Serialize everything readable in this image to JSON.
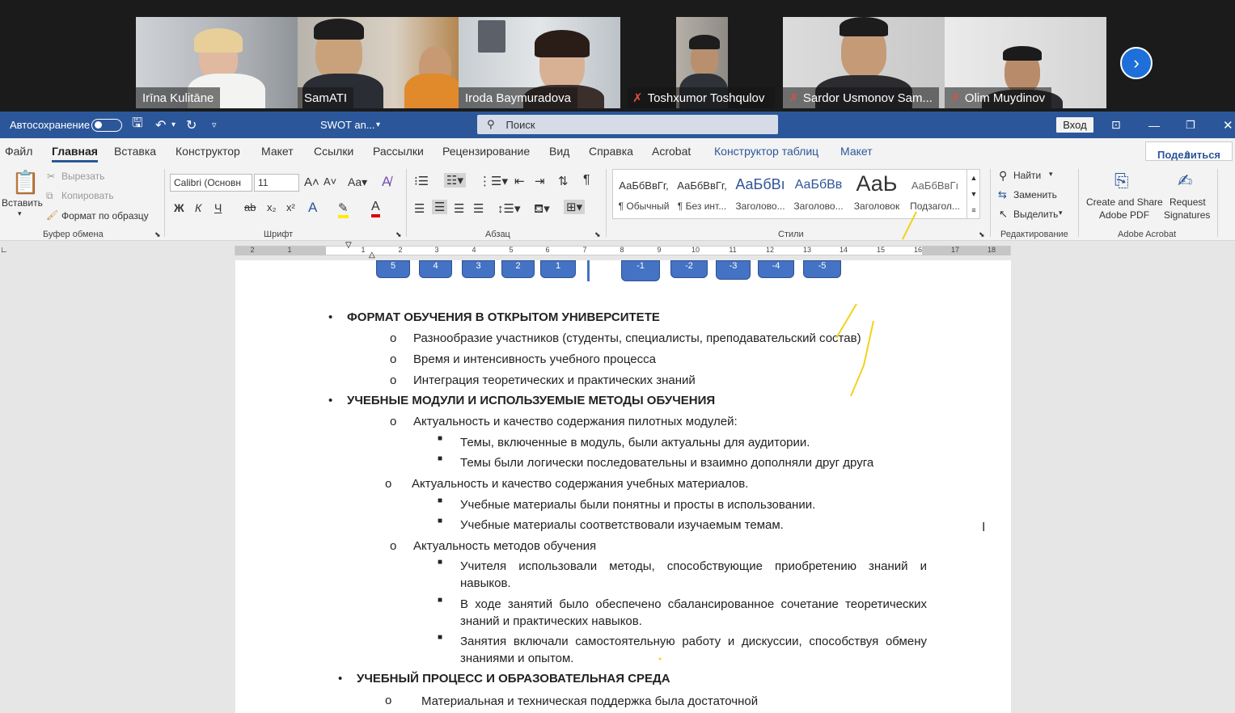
{
  "participants": [
    {
      "name": "Irīna Kulitāne",
      "muted": false
    },
    {
      "name": "SamATI",
      "muted": false
    },
    {
      "name": "Iroda Baymuradova",
      "muted": false
    },
    {
      "name": "Toshxumor Toshqulov",
      "muted": true
    },
    {
      "name": "Sardor Usmonov Sam...",
      "muted": true
    },
    {
      "name": "Olim Muydinov",
      "muted": true
    }
  ],
  "titlebar": {
    "autosave_label": "Автосохранение",
    "doc_title": "SWOT an...",
    "search_placeholder": "Поиск",
    "login": "Вход"
  },
  "menu": {
    "tabs": [
      "Файл",
      "Главная",
      "Вставка",
      "Конструктор",
      "Макет",
      "Ссылки",
      "Рассылки",
      "Рецензирование",
      "Вид",
      "Справка",
      "Acrobat",
      "Конструктор таблиц",
      "Макет"
    ],
    "share": "Поделиться"
  },
  "ribbon": {
    "clipboard": {
      "paste": "Вставить",
      "cut": "Вырезать",
      "copy": "Копировать",
      "format_painter": "Формат по образцу",
      "group": "Буфер обмена"
    },
    "font": {
      "name": "Calibri (Основн",
      "size": "11",
      "group": "Шрифт"
    },
    "paragraph": {
      "group": "Абзац"
    },
    "styles": {
      "items": [
        {
          "preview": "АаБбВвГг,",
          "name": "¶ Обычный"
        },
        {
          "preview": "АаБбВвГг,",
          "name": "¶ Без инт..."
        },
        {
          "preview": "АаБбВı",
          "name": "Заголово..."
        },
        {
          "preview": "АаБбВв",
          "name": "Заголово..."
        },
        {
          "preview": "АаЬ",
          "name": "Заголовок"
        },
        {
          "preview": "АаБбВвГı",
          "name": "Подзагол..."
        }
      ],
      "group": "Стили"
    },
    "editing": {
      "find": "Найти",
      "replace": "Заменить",
      "select": "Выделить",
      "group": "Редактирование"
    },
    "acrobat": {
      "create": "Create and Share",
      "create2": "Adobe PDF",
      "request": "Request",
      "request2": "Signatures",
      "group": "Adobe Acrobat"
    }
  },
  "ruler_ticks": [
    "2",
    "1",
    "1",
    "2",
    "3",
    "4",
    "5",
    "6",
    "7",
    "8",
    "9",
    "10",
    "11",
    "12",
    "13",
    "14",
    "15",
    "16",
    "17",
    "18"
  ],
  "scale_boxes": [
    "5",
    "4",
    "3",
    "2",
    "1",
    "-1",
    "-2",
    "-3",
    "-4",
    "-5"
  ],
  "document": {
    "h1": "ФОРМАТ ОБУЧЕНИЯ В ОТКРЫТОМ УНИВЕРСИТЕТЕ",
    "l1": "Разнообразие участников (студенты, специалисты, преподавательский состав)",
    "l2": "Время и интенсивность учебного процесса",
    "l3": "Интеграция теоретических и практических знаний",
    "h2": "УЧЕБНЫЕ МОДУЛИ И ИСПОЛЬЗУЕМЫЕ МЕТОДЫ ОБУЧЕНИЯ",
    "l4": "Актуальность и качество содержания пилотных модулей:",
    "l5": "Темы, включенные в модуль, были актуальны для аудитории.",
    "l6": "Темы были логически последовательны и взаимно дополняли друг друга",
    "l7": "Актуальность и качество содержания учебных материалов.",
    "l8": "Учебные материалы были понятны и просты в использовании.",
    "l9": "Учебные материалы соответствовали изучаемым темам.",
    "l10": "Актуальность методов обучения",
    "l11a": "Учителя использовали методы, способствующие приобретению знаний и",
    "l11b": "навыков.",
    "l12a": "В ходе занятий было обеспечено сбалансированное сочетание теоретических",
    "l12b": "знаний и практических навыков.",
    "l13a": "Занятия включали самостоятельную работу и дискуссии, способствуя обмену",
    "l13b": "знаниями и опытом.",
    "h3": "УЧЕБНЫЙ ПРОЦЕСС И ОБРАЗОВАТЕЛЬНАЯ СРЕДА",
    "l14": "Материальная и техническая поддержка была достаточной"
  }
}
